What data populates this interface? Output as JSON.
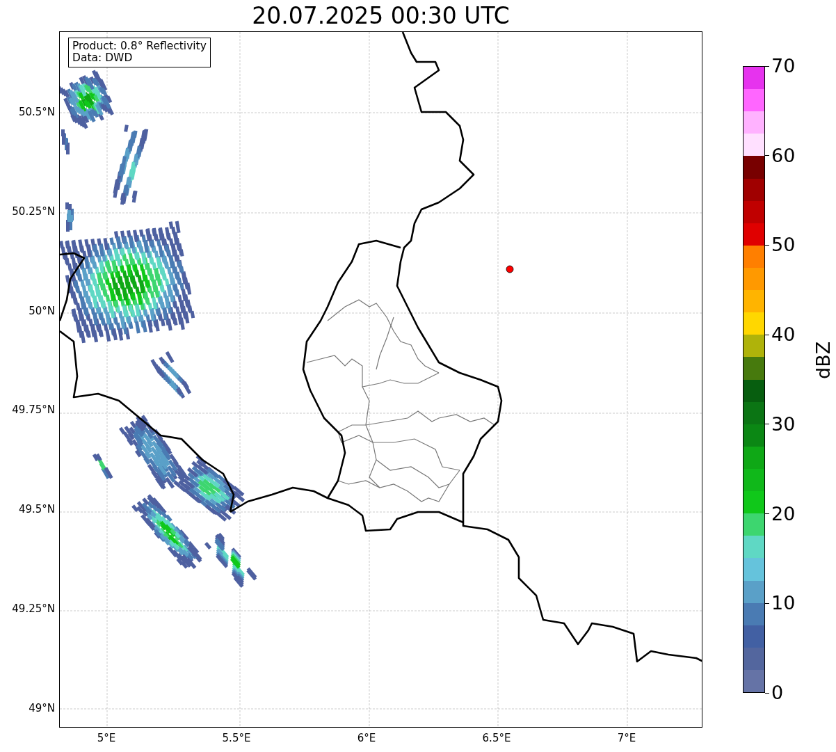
{
  "title": "20.07.2025 00:30 UTC",
  "info_box": {
    "lines": [
      "Product: 0.8° Reflectivity",
      "Data: DWD"
    ]
  },
  "map": {
    "y_ticks": [
      "50.5°N",
      "50.25°N",
      "50°N",
      "49.75°N",
      "49.5°N",
      "49.25°N",
      "49°N"
    ],
    "x_ticks": [
      "5°E",
      "5.5°E",
      "6°E",
      "6.5°E",
      "7°E"
    ]
  },
  "colorbar": {
    "label": "dBZ",
    "ticks": [
      "70",
      "60",
      "50",
      "40",
      "30",
      "20",
      "10",
      "0"
    ],
    "segments": [
      {
        "color": "#e633ee"
      },
      {
        "color": "#ff66ff"
      },
      {
        "color": "#ffb2ff"
      },
      {
        "color": "#ffe0ff"
      },
      {
        "color": "#780000"
      },
      {
        "color": "#a00000"
      },
      {
        "color": "#c00000"
      },
      {
        "color": "#e00000"
      },
      {
        "color": "#ff7f00"
      },
      {
        "color": "#ff9900"
      },
      {
        "color": "#ffb400"
      },
      {
        "color": "#ffd700"
      },
      {
        "color": "#afb30a"
      },
      {
        "color": "#477a0d"
      },
      {
        "color": "#075e0f"
      },
      {
        "color": "#0b7514"
      },
      {
        "color": "#0b8714"
      },
      {
        "color": "#0fa816"
      },
      {
        "color": "#10b81a"
      },
      {
        "color": "#10c81a"
      },
      {
        "color": "#3dd66f"
      },
      {
        "color": "#5fd8c4"
      },
      {
        "color": "#65c3dc"
      },
      {
        "color": "#5aa0c8"
      },
      {
        "color": "#4a7bb3"
      },
      {
        "color": "#4260a3"
      },
      {
        "color": "#53669e"
      },
      {
        "color": "#6573a6"
      }
    ]
  }
}
